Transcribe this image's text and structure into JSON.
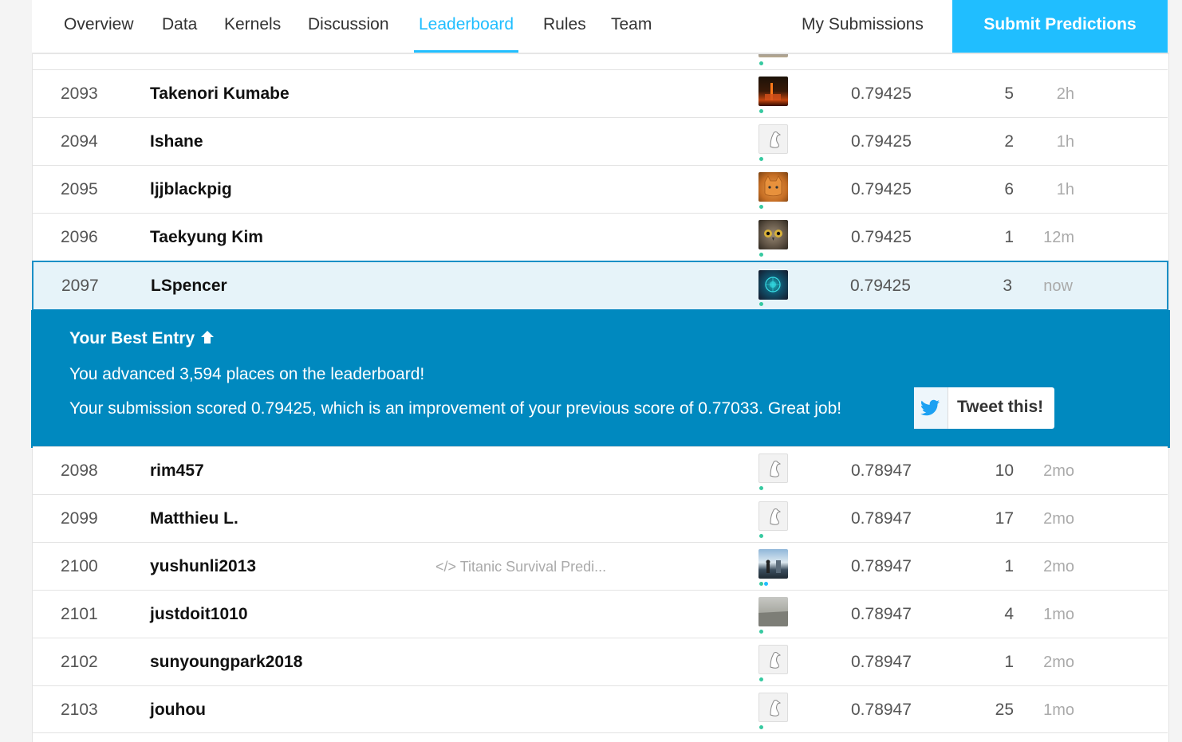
{
  "nav": {
    "tabs": [
      {
        "label": "Overview"
      },
      {
        "label": "Data"
      },
      {
        "label": "Kernels"
      },
      {
        "label": "Discussion"
      },
      {
        "label": "Leaderboard"
      },
      {
        "label": "Rules"
      },
      {
        "label": "Team"
      }
    ],
    "active_tab": "Leaderboard",
    "my_submissions": "My Submissions",
    "submit": "Submit Predictions"
  },
  "colors": {
    "accent": "#20BEFF",
    "banner": "#0089BF",
    "highlight_border": "#1a8fc6"
  },
  "rows_above": [
    {
      "rank": "2093",
      "name": "Takenori Kumabe",
      "kernel": "",
      "avatar": "city",
      "score": "0.79425",
      "entries": "5",
      "last": "2h"
    },
    {
      "rank": "2094",
      "name": "Ishane",
      "kernel": "",
      "avatar": "goose",
      "score": "0.79425",
      "entries": "2",
      "last": "1h"
    },
    {
      "rank": "2095",
      "name": "ljjblackpig",
      "kernel": "",
      "avatar": "cat",
      "score": "0.79425",
      "entries": "6",
      "last": "1h"
    },
    {
      "rank": "2096",
      "name": "Taekyung Kim",
      "kernel": "",
      "avatar": "owl",
      "score": "0.79425",
      "entries": "1",
      "last": "12m"
    }
  ],
  "current": {
    "rank": "2097",
    "name": "LSpencer",
    "avatar": "brain",
    "score": "0.79425",
    "entries": "3",
    "last": "now"
  },
  "best_entry": {
    "title": "Your Best Entry",
    "title_icon": "arrow-up-icon",
    "line1": "You advanced 3,594 places on the leaderboard!",
    "line2": "Your submission scored 0.79425, which is an improvement of your previous score of 0.77033. Great job!",
    "tweet_label": "Tweet this!",
    "tweet_icon": "twitter-icon"
  },
  "rows_below": [
    {
      "rank": "2098",
      "name": "rim457",
      "kernel": "",
      "avatar": "goose",
      "score": "0.78947",
      "entries": "10",
      "last": "2mo"
    },
    {
      "rank": "2099",
      "name": "Matthieu L.",
      "kernel": "",
      "avatar": "goose",
      "score": "0.78947",
      "entries": "17",
      "last": "2mo"
    },
    {
      "rank": "2100",
      "name": "yushunli2013",
      "kernel": "Titanic Survival Predi...",
      "avatar": "photo",
      "score": "0.78947",
      "entries": "1",
      "last": "2mo"
    },
    {
      "rank": "2101",
      "name": "justdoit1010",
      "kernel": "",
      "avatar": "sea",
      "score": "0.78947",
      "entries": "4",
      "last": "1mo"
    },
    {
      "rank": "2102",
      "name": "sunyoungpark2018",
      "kernel": "",
      "avatar": "goose",
      "score": "0.78947",
      "entries": "1",
      "last": "2mo"
    },
    {
      "rank": "2103",
      "name": "jouhou",
      "kernel": "",
      "avatar": "goose",
      "score": "0.78947",
      "entries": "25",
      "last": "1mo"
    }
  ]
}
